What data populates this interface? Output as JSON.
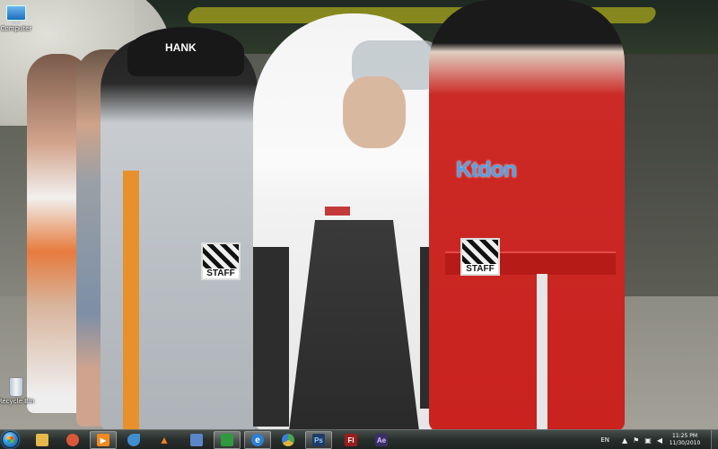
{
  "desktop": {
    "icons": [
      {
        "label": "Computer",
        "icon": "computer-icon"
      },
      {
        "label": "Recycle Bin",
        "icon": "recycle-bin-icon"
      }
    ],
    "wallpaper": {
      "cap_text": "HANK",
      "suit_brand": "Ktdon",
      "badge_1": "STAFF",
      "badge_2": "STAFF"
    }
  },
  "taskbar": {
    "start_icon": "windows-start-icon",
    "pinned": [
      {
        "icon": "explorer-icon",
        "glyph": "",
        "color": "#e7b84a"
      },
      {
        "icon": "paint-icon",
        "glyph": "",
        "color": "#d9583a"
      },
      {
        "icon": "media-player-icon",
        "glyph": "▶",
        "color": "#f08a1c"
      },
      {
        "icon": "bird-icon",
        "glyph": "",
        "color": "#3f8fd0"
      },
      {
        "icon": "vlc-icon",
        "glyph": "▲",
        "color": "#f2811d"
      },
      {
        "icon": "remote-desktop-icon",
        "glyph": "",
        "color": "#5b86c8"
      },
      {
        "icon": "green-app-icon",
        "glyph": "",
        "color": "#2e9a3d"
      },
      {
        "icon": "internet-explorer-icon",
        "glyph": "e",
        "color": "#2b7fd5"
      },
      {
        "icon": "control-panel-icon",
        "glyph": "",
        "color": "#4aa84e"
      },
      {
        "icon": "photoshop-icon",
        "glyph": "Ps",
        "color": "#1f3b66"
      },
      {
        "icon": "flash-icon",
        "glyph": "Fl",
        "color": "#9a1d1d"
      },
      {
        "icon": "after-effects-icon",
        "glyph": "Ae",
        "color": "#3b2f66"
      }
    ],
    "tray": {
      "language": "EN",
      "time": "11:25 PM",
      "date": "11/30/2010"
    }
  }
}
